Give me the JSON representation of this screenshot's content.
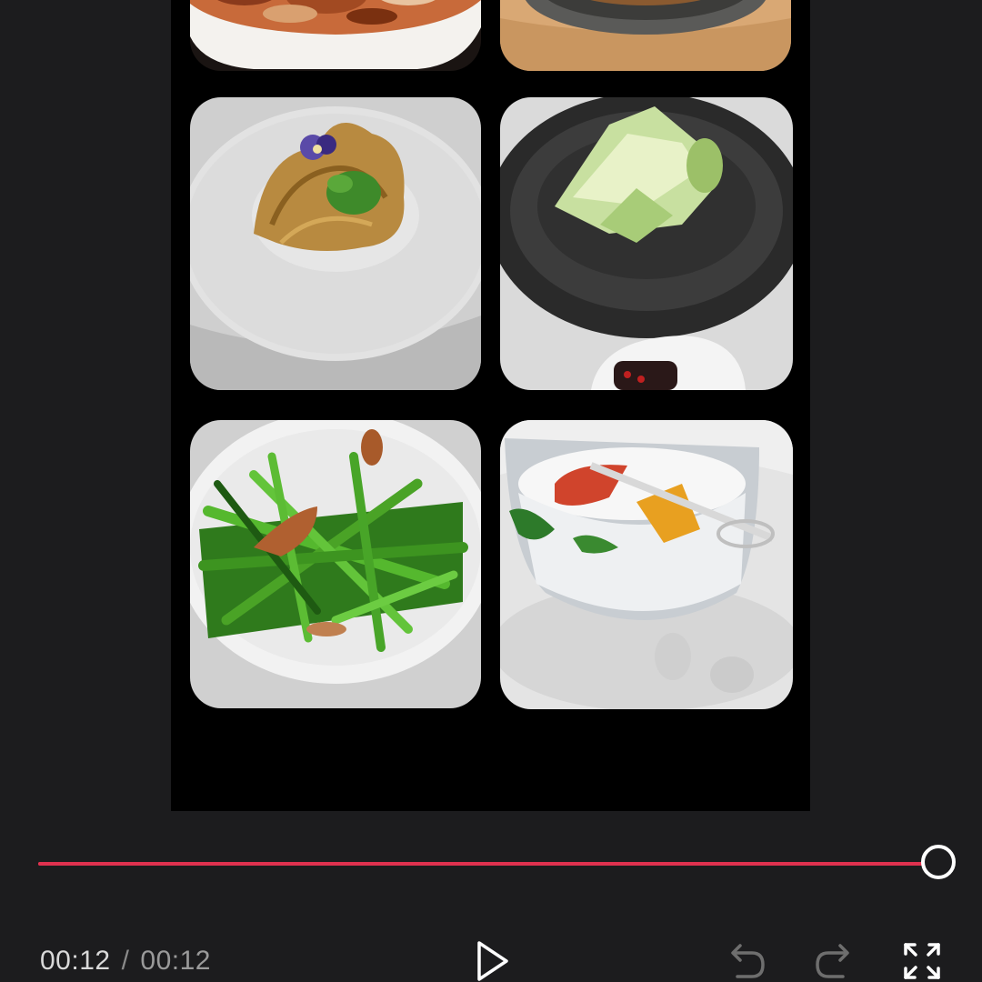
{
  "player": {
    "current_time": "00:12",
    "separator": "/",
    "duration": "00:12",
    "progress_percent": 100,
    "accent_color": "#e0314f"
  },
  "video": {
    "tiles": [
      {
        "subject": "braised-meat-dish"
      },
      {
        "subject": "clay-pot-dish"
      },
      {
        "subject": "tripe-with-flower-garnish"
      },
      {
        "subject": "shaved-melon-on-black-plate"
      },
      {
        "subject": "stir-fried-greens"
      },
      {
        "subject": "panna-cotta-dessert-glass"
      }
    ]
  },
  "controls": {
    "play_icon": "play-icon",
    "undo_icon": "undo-icon",
    "redo_icon": "redo-icon",
    "fullscreen_icon": "fullscreen-icon"
  }
}
